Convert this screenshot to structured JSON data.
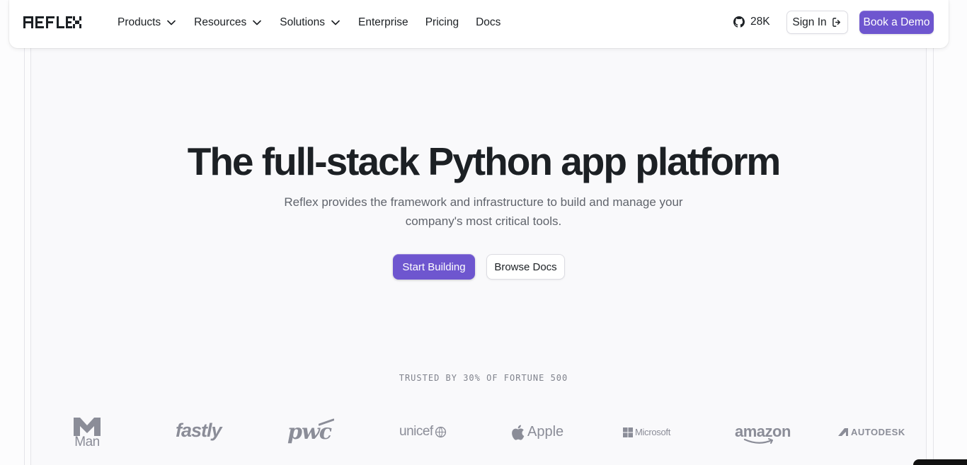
{
  "navbar": {
    "logo_text": "REFLEX",
    "links": [
      {
        "label": "Products",
        "dropdown": true
      },
      {
        "label": "Resources",
        "dropdown": true
      },
      {
        "label": "Solutions",
        "dropdown": true
      },
      {
        "label": "Enterprise",
        "dropdown": false
      },
      {
        "label": "Pricing",
        "dropdown": false
      },
      {
        "label": "Docs",
        "dropdown": false
      }
    ],
    "github_stars": "28K",
    "signin_label": "Sign In",
    "demo_label": "Book a Demo"
  },
  "hero": {
    "title": "The full-stack Python app platform",
    "subtitle": "Reflex provides the framework and infrastructure to build and manage your company's most critical tools.",
    "primary_button": "Start Building",
    "secondary_button": "Browse Docs"
  },
  "trusted": {
    "label": "TRUSTED BY 30% OF FORTUNE 500",
    "logos": [
      {
        "name": "Man",
        "icon": "man-logo"
      },
      {
        "name": "fastly",
        "icon": "fastly-logo"
      },
      {
        "name": "pwc",
        "icon": "pwc-logo"
      },
      {
        "name": "unicef",
        "icon": "unicef-logo"
      },
      {
        "name": "Apple",
        "icon": "apple-logo"
      },
      {
        "name": "Microsoft",
        "icon": "microsoft-logo"
      },
      {
        "name": "amazon",
        "icon": "amazon-logo"
      },
      {
        "name": "AUTODESK",
        "icon": "autodesk-logo"
      }
    ]
  },
  "colors": {
    "accent": "#6e56cf",
    "text": "#1c2024",
    "muted": "#60646c",
    "logo_gray": "#8b8d98"
  }
}
